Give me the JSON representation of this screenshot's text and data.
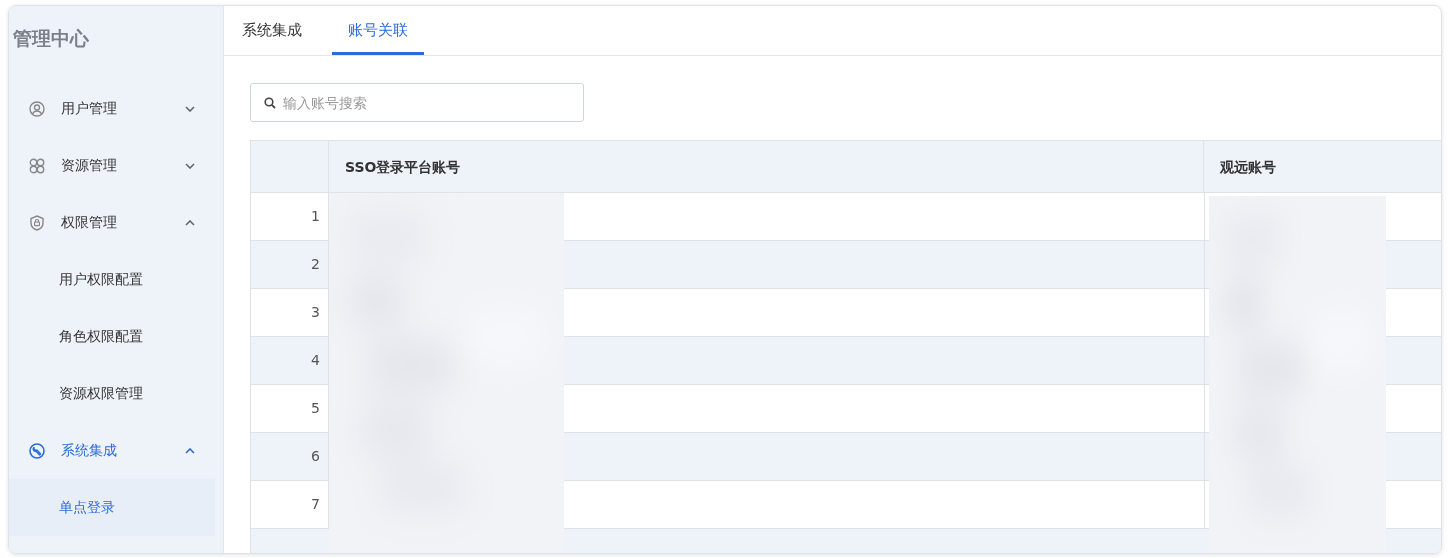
{
  "sidebar": {
    "title": "管理中心",
    "items": [
      {
        "label": "用户管理",
        "expanded": false,
        "active": false
      },
      {
        "label": "资源管理",
        "expanded": false,
        "active": false
      },
      {
        "label": "权限管理",
        "expanded": true,
        "active": false,
        "children": [
          {
            "label": "用户权限配置",
            "selected": false
          },
          {
            "label": "角色权限配置",
            "selected": false
          },
          {
            "label": "资源权限管理",
            "selected": false
          }
        ]
      },
      {
        "label": "系统集成",
        "expanded": true,
        "active": true,
        "children": [
          {
            "label": "单点登录",
            "selected": true
          }
        ]
      }
    ]
  },
  "tabs": [
    {
      "label": "系统集成",
      "selected": false
    },
    {
      "label": "账号关联",
      "selected": true
    }
  ],
  "search": {
    "placeholder": "输入账号搜索"
  },
  "table": {
    "columns": [
      "SSO登录平台账号",
      "观远账号"
    ],
    "rows": [
      {
        "index": "1"
      },
      {
        "index": "2"
      },
      {
        "index": "3"
      },
      {
        "index": "4"
      },
      {
        "index": "5"
      },
      {
        "index": "6"
      },
      {
        "index": "7"
      }
    ]
  }
}
